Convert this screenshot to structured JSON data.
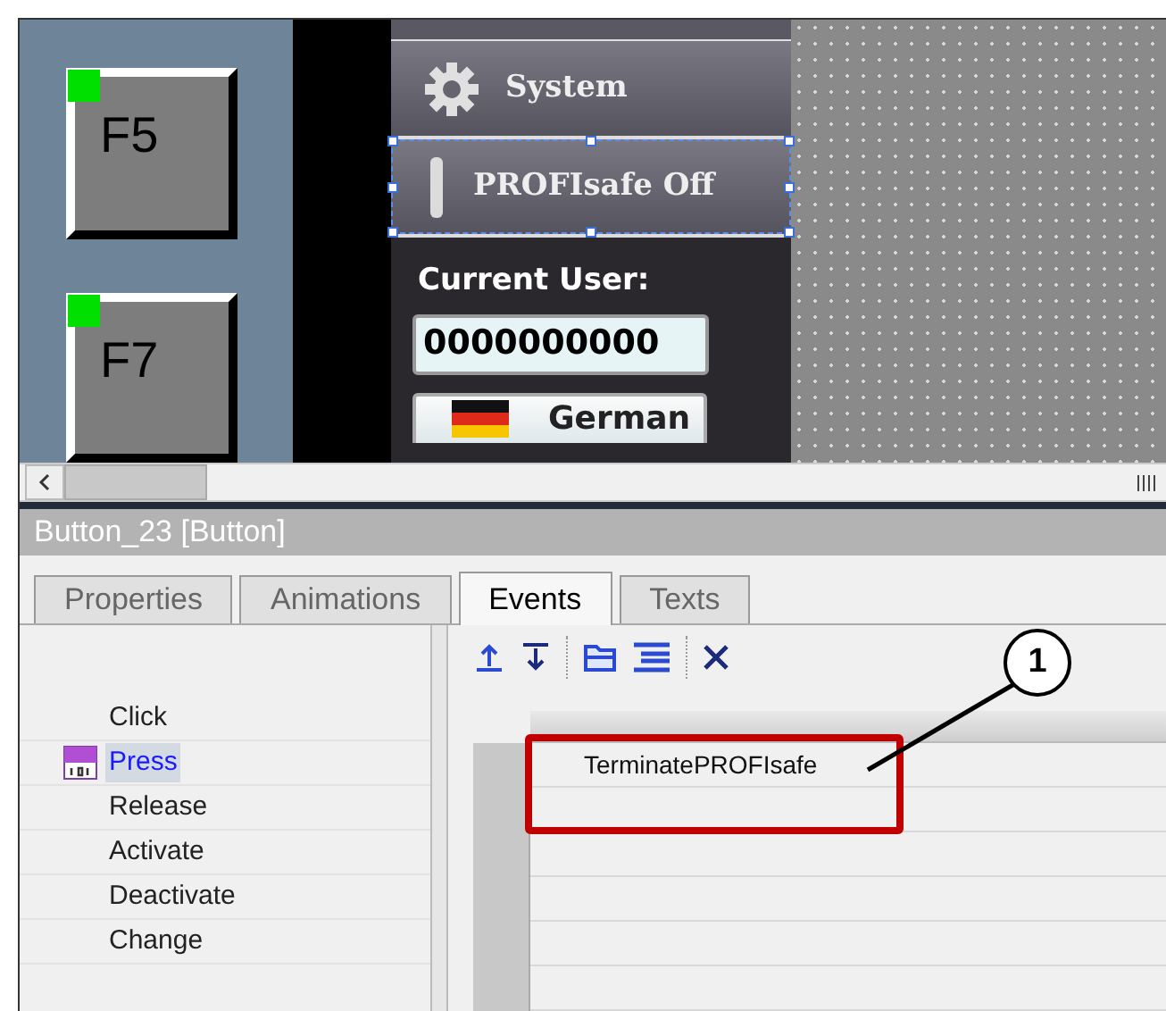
{
  "canvas": {
    "function_keys": [
      {
        "label": "F5"
      },
      {
        "label": "F7"
      }
    ],
    "menu_buttons": [
      {
        "label": "System",
        "kind": "gear",
        "selected": false
      },
      {
        "label": "PROFIsafe Off",
        "kind": "bar",
        "selected": true
      }
    ],
    "user_label": "Current User:",
    "user_field": "0000000000",
    "language_button": "German"
  },
  "inspector": {
    "title": "Button_23 [Button]",
    "tabs": [
      {
        "label": "Properties",
        "selected": false
      },
      {
        "label": "Animations",
        "selected": false
      },
      {
        "label": "Events",
        "selected": true
      },
      {
        "label": "Texts",
        "selected": false
      }
    ],
    "events": [
      {
        "label": "Click",
        "selected": false
      },
      {
        "label": "Press",
        "selected": true
      },
      {
        "label": "Release",
        "selected": false
      },
      {
        "label": "Activate",
        "selected": false
      },
      {
        "label": "Deactivate",
        "selected": false
      },
      {
        "label": "Change",
        "selected": false
      }
    ],
    "functions": [
      "TerminatePROFIsafe"
    ]
  },
  "callout": "1"
}
